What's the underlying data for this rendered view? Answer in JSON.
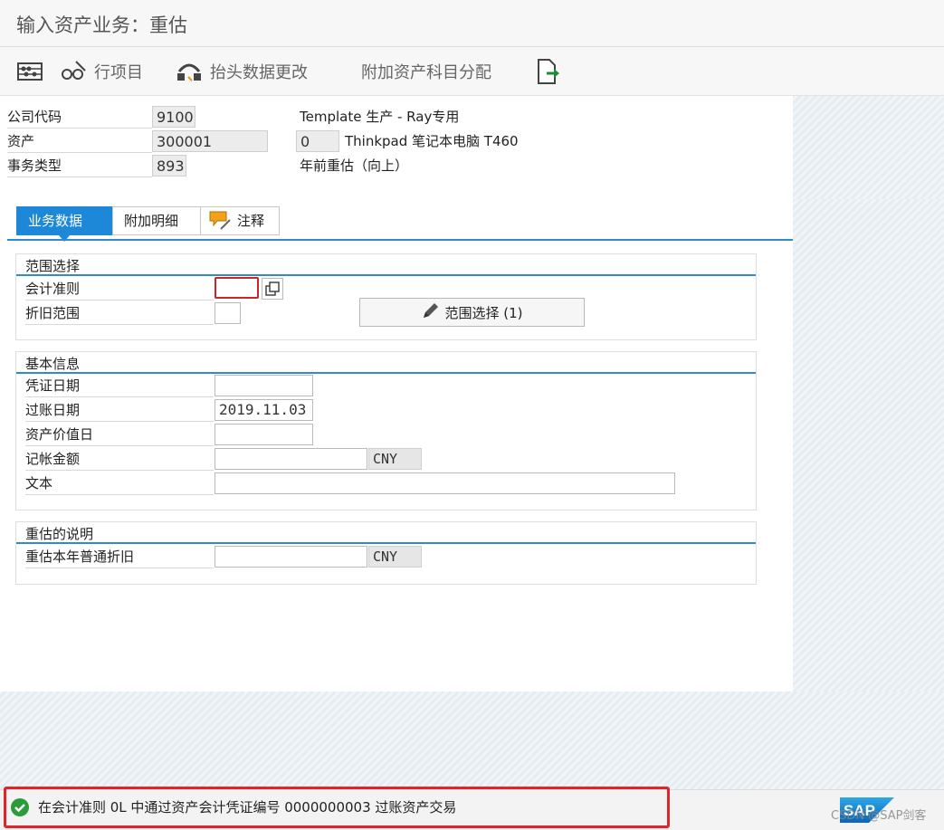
{
  "window": {
    "title": "输入资产业务：重估"
  },
  "toolbar": {
    "items": [
      {
        "label": "",
        "icon": "abacus-icon"
      },
      {
        "label": "行项目",
        "icon": "glasses-pencil-icon"
      },
      {
        "label": "抬头数据更改",
        "icon": "header-data-icon"
      },
      {
        "label": "附加资产科目分配",
        "icon": ""
      },
      {
        "label": "",
        "icon": "exit-document-icon"
      }
    ]
  },
  "header": {
    "company_code_label": "公司代码",
    "company_code": "9100",
    "company_name": "Template 生产 - Ray专用",
    "asset_label": "资产",
    "asset_number": "300001",
    "asset_sub": "0",
    "asset_desc": "Thinkpad 笔记本电脑 T460",
    "txn_type_label": "事务类型",
    "txn_type": "893",
    "txn_type_desc": "年前重估（向上）"
  },
  "tabs": [
    {
      "label": "业务数据",
      "active": true
    },
    {
      "label": "附加明细",
      "active": false
    },
    {
      "label": "注释",
      "active": false
    }
  ],
  "range_group": {
    "title": "范围选择",
    "accounting_principle_label": "会计准则",
    "accounting_principle_value": "",
    "depr_area_label": "折旧范围",
    "depr_area_value": "",
    "range_button_label": "范围选择 (1)"
  },
  "basic_group": {
    "title": "基本信息",
    "doc_date_label": "凭证日期",
    "doc_date_value": "",
    "posting_date_label": "过账日期",
    "posting_date_value": "2019.11.03",
    "asset_value_date_label": "资产价值日",
    "asset_value_date_value": "",
    "amount_label": "记帐金额",
    "amount_value": "",
    "amount_currency": "CNY",
    "text_label": "文本",
    "text_value": ""
  },
  "reval_group": {
    "title": "重估的说明",
    "reval_label": "重估本年普通折旧",
    "reval_value": "",
    "reval_currency": "CNY"
  },
  "status": {
    "message": "在会计准则 0L 中通过资产会计凭证编号 0000000003 过账资产交易",
    "type": "success"
  },
  "footer": {
    "logo": "SAP",
    "watermark": "CSDN @SAP剑客"
  },
  "colors": {
    "accent": "#1e88d8",
    "success": "#2a9d3a",
    "highlight_border": "#e0242a"
  }
}
